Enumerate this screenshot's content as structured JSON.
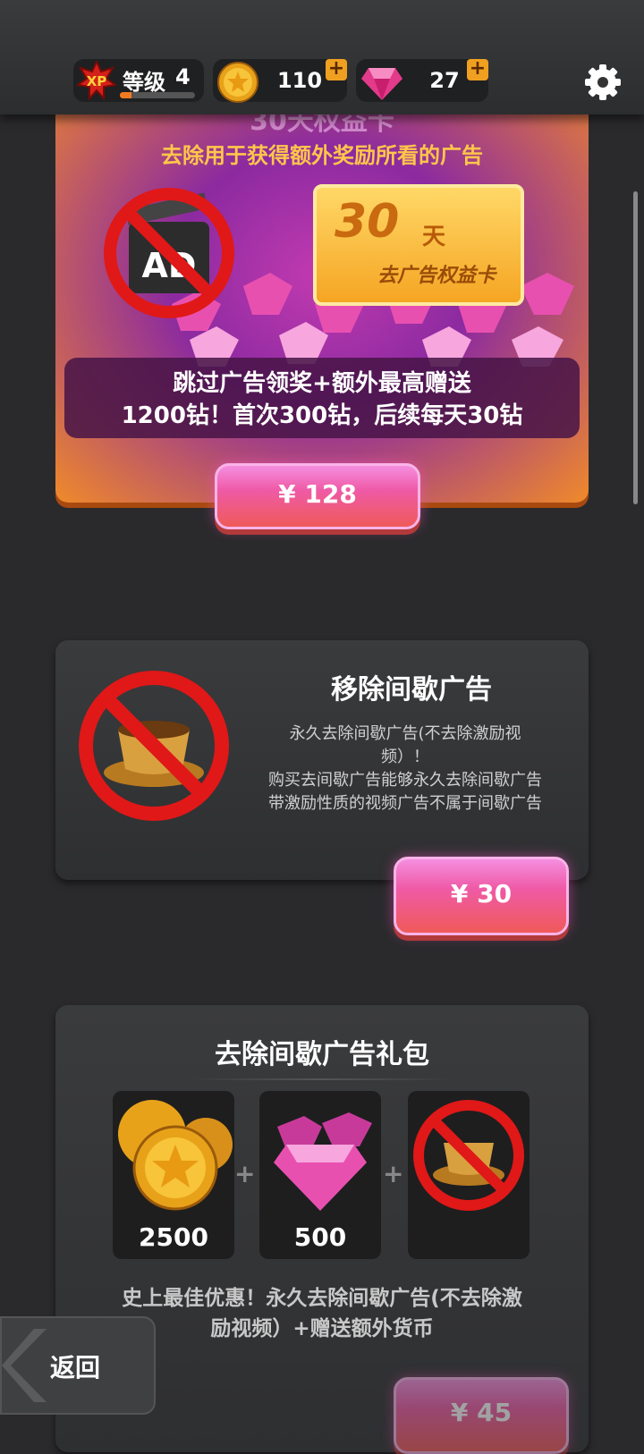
{
  "topbar": {
    "xp_badge": "XP",
    "level_label": "等级",
    "level_value": "4",
    "level_progress": 0.15,
    "coins": "110",
    "gems": "27",
    "icons": [
      "xp-badge-icon",
      "coin-icon",
      "gem-icon",
      "plus-icon",
      "gear-icon"
    ]
  },
  "promo": {
    "title_faded": "30天权益卡",
    "subtitle": "去除用于获得额外奖励所看的广告",
    "ad_icon_text": "AD",
    "card_days": "30",
    "card_unit": "天",
    "card_label": "去广告权益卡",
    "band_line1": "跳过广告领奖+额外最高赠送",
    "band_line2": "1200钻！首次300钻，后续每天30钻",
    "price": "¥ 128"
  },
  "remove_ads": {
    "title": "移除间歇广告",
    "line1": "永久去除间歇广告(不去除激励视",
    "line2": "频）！",
    "line3": "购买去间歇广告能够永久去除间歇广告",
    "line4": "带激励性质的视频广告不属于间歇广告",
    "price": "¥ 30"
  },
  "bundle": {
    "title": "去除间歇广告礼包",
    "coins_amount": "2500",
    "gems_amount": "500",
    "plus": "+",
    "desc_line1": "史上最佳优惠！永久去除间歇广告(不去除激",
    "desc_line2": "励视频）+赠送额外货币",
    "price": "¥ 45"
  },
  "back_button": {
    "label": "返回"
  },
  "colors": {
    "accent_pink": "#ef5aa6",
    "gold": "#f5a523",
    "background": "#2a2a2c"
  }
}
